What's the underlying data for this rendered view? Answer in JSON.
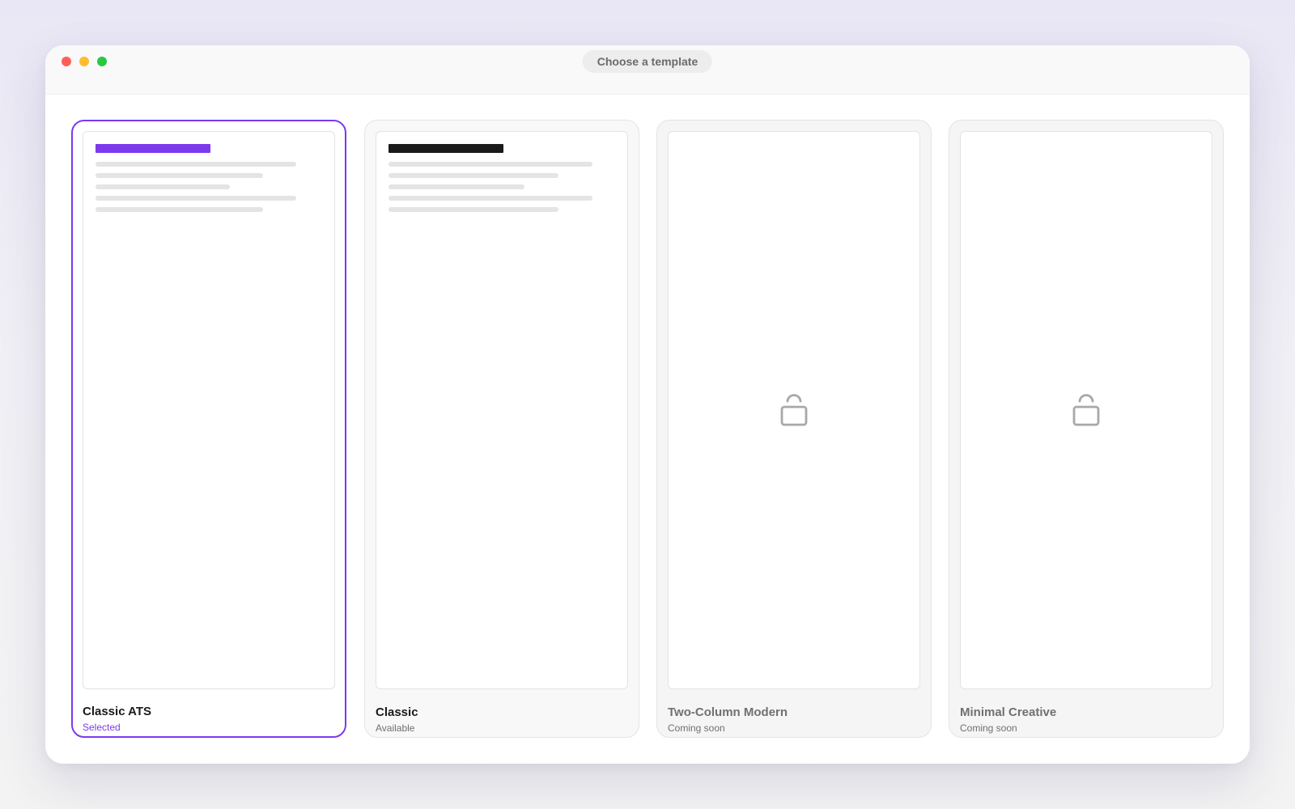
{
  "window": {
    "title": "Choose a template"
  },
  "colors": {
    "accent": "#7c3aed",
    "traffic_close": "#ff5f57",
    "traffic_minimize": "#febc2e",
    "traffic_maximize": "#28c840"
  },
  "templates": [
    {
      "name": "Classic ATS",
      "status": "Selected",
      "state": "selected",
      "heading_color": "#7c3aed"
    },
    {
      "name": "Classic",
      "status": "Available",
      "state": "available",
      "heading_color": "#1a1a1a"
    },
    {
      "name": "Two-Column Modern",
      "status": "Coming soon",
      "state": "locked",
      "icon": "lock-icon"
    },
    {
      "name": "Minimal Creative",
      "status": "Coming soon",
      "state": "locked",
      "icon": "lock-icon"
    }
  ]
}
